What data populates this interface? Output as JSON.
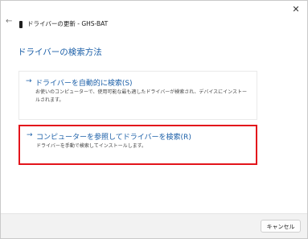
{
  "window": {
    "close_glyph": "✕"
  },
  "titlebar": {
    "back_glyph": "←",
    "title": "ドライバーの更新 - GHS-BAT"
  },
  "page": {
    "heading": "ドライバーの検索方法"
  },
  "options": [
    {
      "arrow": "→",
      "title": "ドライバーを自動的に検索(S)",
      "description": "お使いのコンピューターで、使用可能な最も適したドライバーが検索され、デバイスにインストールされます。"
    },
    {
      "arrow": "→",
      "title": "コンピューターを参照してドライバーを検索(R)",
      "description": "ドライバーを手動で検索してインストールします。"
    }
  ],
  "footer": {
    "cancel_label": "キャンセル"
  },
  "colors": {
    "accent": "#1b5fa8",
    "highlight_border": "#e3141b"
  }
}
